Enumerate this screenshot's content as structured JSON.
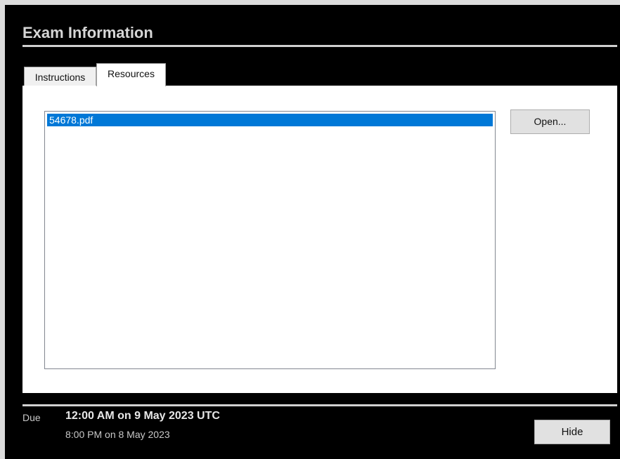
{
  "window": {
    "title": "Exam Information"
  },
  "tabs": [
    {
      "label": "Instructions",
      "selected": false
    },
    {
      "label": "Resources",
      "selected": true
    }
  ],
  "resources": {
    "files": [
      {
        "name": "54678.pdf",
        "selected": true
      }
    ],
    "open_button_label": "Open..."
  },
  "footer": {
    "due_label": "Due",
    "due_utc": "12:00 AM on 9 May 2023 UTC",
    "due_local": "8:00 PM on 8 May 2023",
    "hide_button_label": "Hide"
  },
  "colors": {
    "window_background": "#000000",
    "selection": "#0078d7",
    "panel": "#ffffff"
  }
}
